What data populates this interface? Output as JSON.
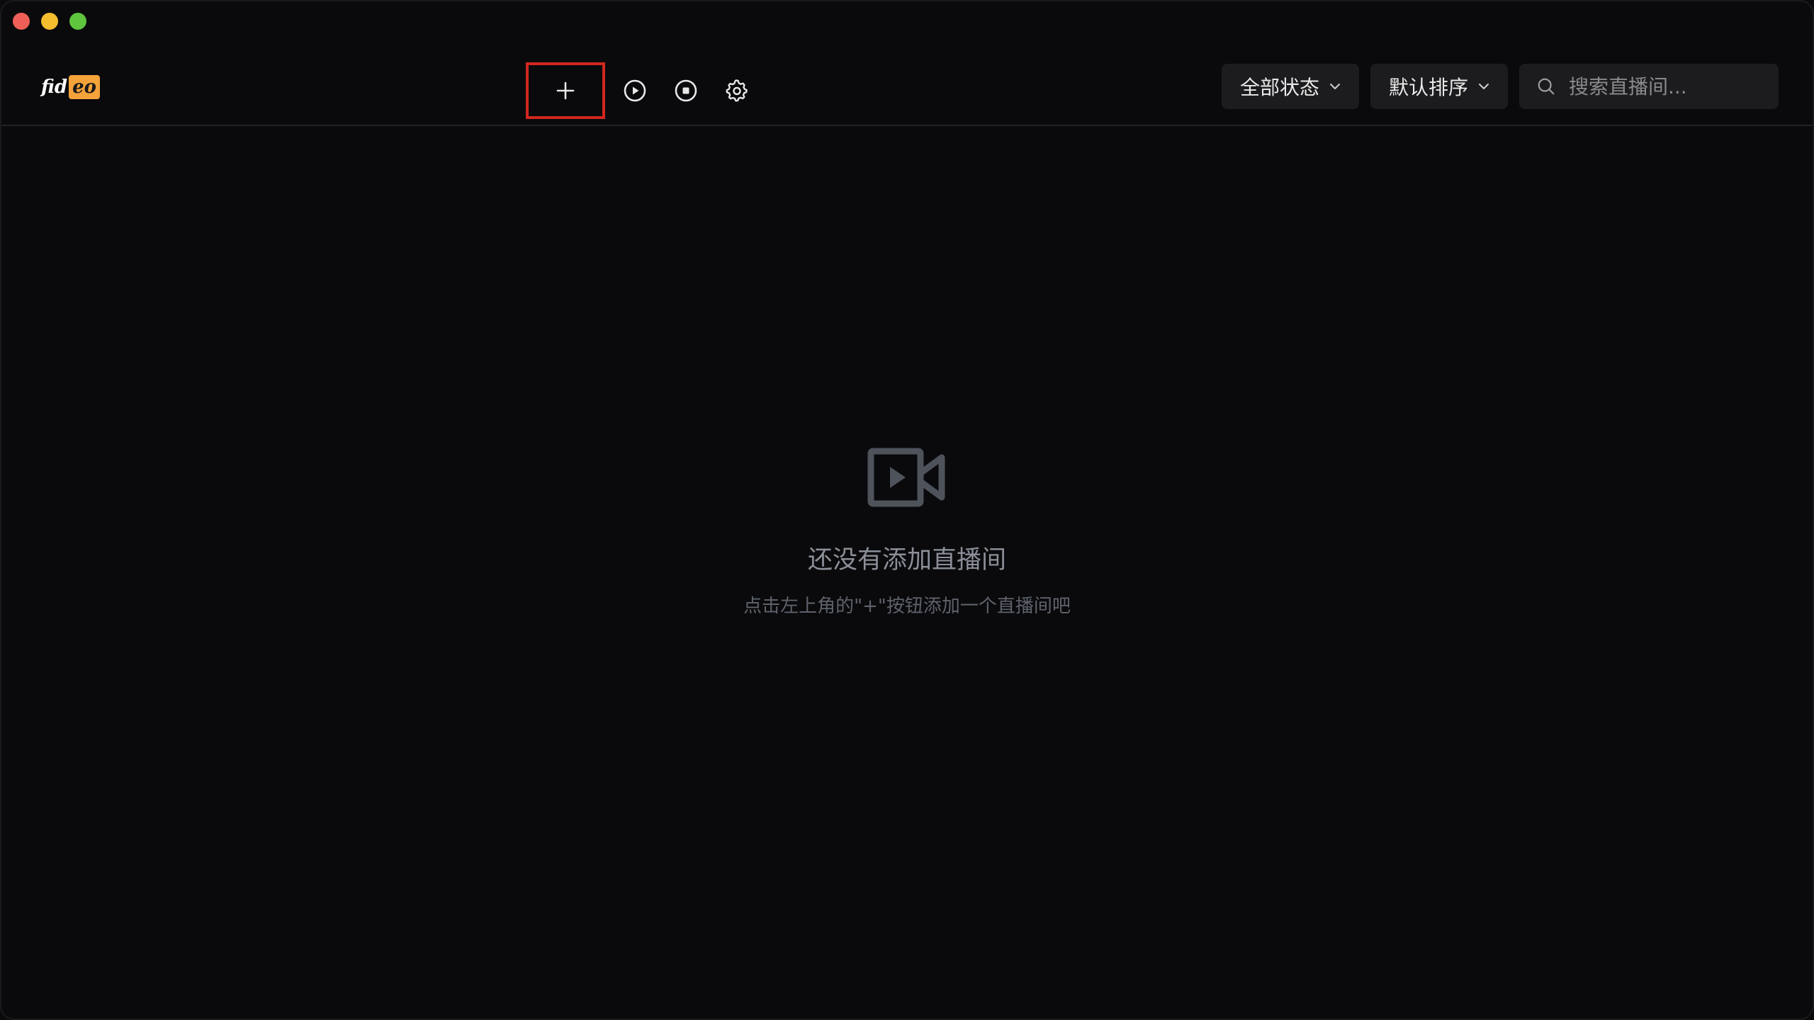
{
  "window": {
    "controls": [
      "close",
      "minimize",
      "maximize"
    ]
  },
  "logo": {
    "part1": "fid",
    "part2": "eo"
  },
  "toolbar": {
    "add_icon": "plus-icon",
    "play_icon": "play-circle-icon",
    "stop_icon": "stop-circle-icon",
    "settings_icon": "gear-icon"
  },
  "filters": {
    "status_label": "全部状态",
    "sort_label": "默认排序",
    "search_placeholder": "搜索直播间..."
  },
  "empty_state": {
    "icon": "video-camera-icon",
    "title": "还没有添加直播间",
    "subtitle": "点击左上角的\"+\"按钮添加一个直播间吧"
  },
  "colors": {
    "background": "#0a0a0c",
    "accent_logo": "#f4a23a",
    "highlight_box": "#d1271f"
  }
}
